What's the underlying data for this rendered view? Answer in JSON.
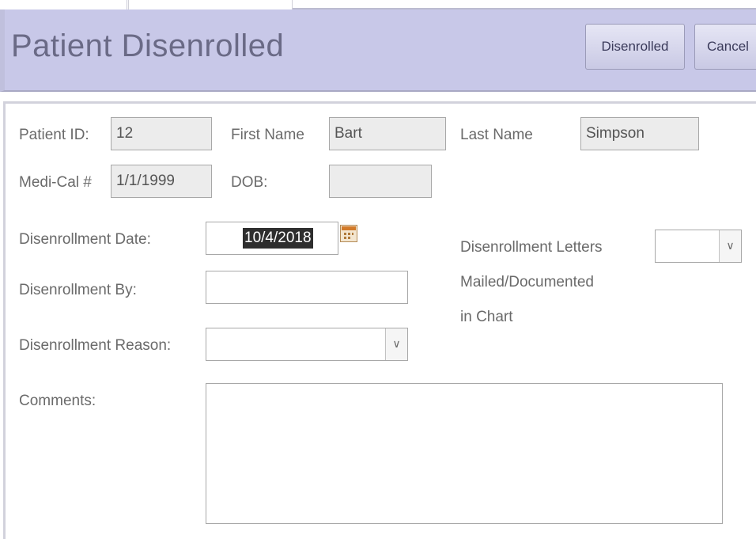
{
  "header": {
    "title": "Patient Disenrolled",
    "disenrolled_button": "Disenrolled",
    "cancel_button": "Cancel"
  },
  "patient": {
    "patient_id_label": "Patient ID:",
    "patient_id": "12",
    "first_name_label": "First Name",
    "first_name": "Bart",
    "last_name_label": "Last Name",
    "last_name": "Simpson",
    "medical_label": "Medi-Cal #",
    "medical_value": "1/1/1999",
    "dob_label": "DOB:",
    "dob_value": ""
  },
  "disenrollment": {
    "date_label": "Disenrollment Date:",
    "date_value": "10/4/2018",
    "by_label": "Disenrollment By:",
    "by_value": "",
    "reason_label": "Disenrollment Reason:",
    "reason_value": "",
    "letters_label_line1": "Disenrollment Letters",
    "letters_label_line2": "Mailed/Documented",
    "letters_label_line3": "in Chart",
    "letters_value": "",
    "comments_label": "Comments:",
    "comments_value": ""
  },
  "icons": {
    "calendar": "calendar-icon",
    "dropdown": "chevron-down-icon"
  },
  "colors": {
    "header_bg": "#c8c8e8",
    "title_text": "#6a6a86",
    "readonly_bg": "#ececec",
    "selection_bg": "#2e2e2e"
  }
}
